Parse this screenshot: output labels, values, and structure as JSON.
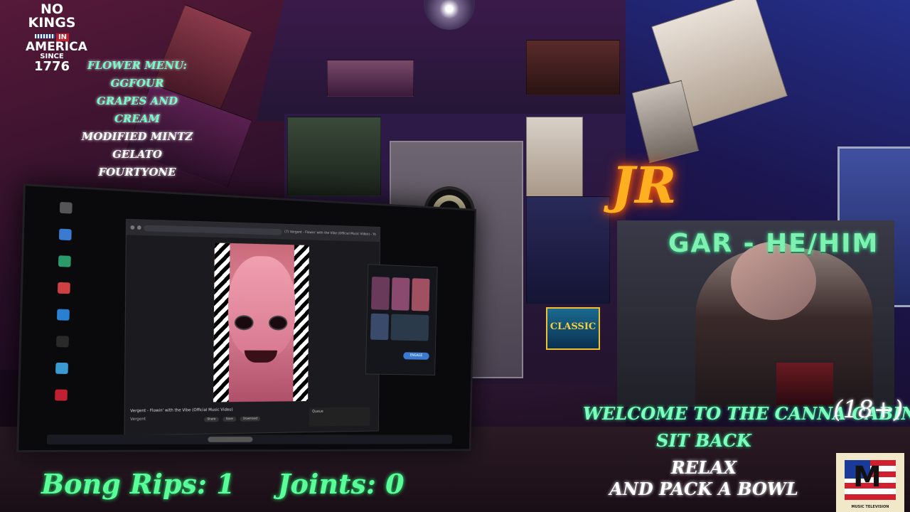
{
  "overlay": {
    "no_kings": {
      "line1": "NO",
      "line2": "KINGS",
      "line3": "IN",
      "line4": "AMERICA",
      "line5": "SINCE",
      "line6": "1776"
    },
    "flower_menu": {
      "heading": "FLOWER MENU:",
      "items": [
        "GGFOUR",
        "GRAPES AND CREAM",
        "MODIFIED MINTZ",
        "GELATO FOURTYONE"
      ],
      "item_colors": [
        "#6effc8",
        "#6effc8",
        "#ffffff",
        "#ffffff"
      ]
    },
    "streamer_name": "GAR - HE/HIM",
    "welcome": {
      "line1": "WELCOME TO THE CANNA CABIN",
      "line2": "SIT BACK",
      "line3": "RELAX",
      "line4": "AND PACK A BOWL",
      "age": "(18+)"
    },
    "counters": {
      "bong_label": "Bong Rips: 1",
      "joints_label": "Joints: 0"
    },
    "mtv_caption": "MUSIC TELEVISION",
    "neon_sign": "JR",
    "classic_sign": "CLASSIC"
  },
  "screen": {
    "browser_tab_title": "(7) Vergent - Flowin' with the Vibe (Official Music Video) - YouTube",
    "video_title": "Vergent - Flowin' with the Vibe (Official Music Video)",
    "channel": "Vergent",
    "actions": [
      "Share",
      "Save",
      "Download"
    ],
    "queue_label": "Queue",
    "side_button": "ENGAGE"
  },
  "colors": {
    "neon_green": "#6effc8",
    "gar_green": "#7ef0b0",
    "neon_orange": "#ffb020"
  }
}
